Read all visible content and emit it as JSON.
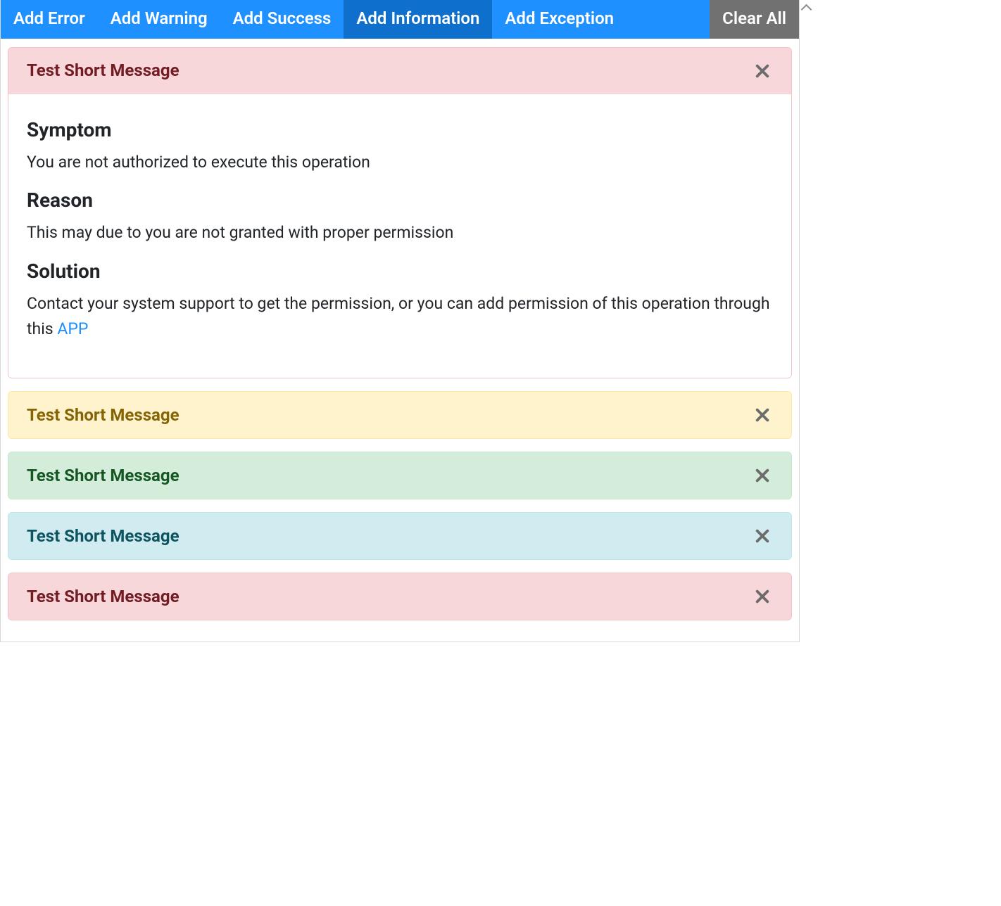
{
  "toolbar": {
    "buttons": [
      {
        "id": "add-error",
        "label": "Add Error",
        "style": "blue"
      },
      {
        "id": "add-warning",
        "label": "Add Warning",
        "style": "blue"
      },
      {
        "id": "add-success",
        "label": "Add Success",
        "style": "blue"
      },
      {
        "id": "add-information",
        "label": "Add Information",
        "style": "blue-active"
      },
      {
        "id": "add-exception",
        "label": "Add Exception",
        "style": "blue"
      },
      {
        "id": "clear-all",
        "label": "Clear All",
        "style": "gray"
      }
    ]
  },
  "messages": [
    {
      "id": "msg-error",
      "variant": "error",
      "title": "Test Short Message",
      "expanded": true,
      "body": {
        "sections": [
          {
            "heading": "Symptom",
            "text": "You are not authorized to execute this operation"
          },
          {
            "heading": "Reason",
            "text": "This may due to you are not granted with proper permission"
          },
          {
            "heading": "Solution",
            "text": "Contact your system support to get the permission, or you can add permission of this operation through this ",
            "link_text": "APP"
          }
        ]
      }
    },
    {
      "id": "msg-warning",
      "variant": "warning",
      "title": "Test Short Message",
      "expanded": false
    },
    {
      "id": "msg-success",
      "variant": "success",
      "title": "Test Short Message",
      "expanded": false
    },
    {
      "id": "msg-info",
      "variant": "info",
      "title": "Test Short Message",
      "expanded": false
    },
    {
      "id": "msg-exception",
      "variant": "error",
      "title": "Test Short Message",
      "expanded": false
    }
  ]
}
